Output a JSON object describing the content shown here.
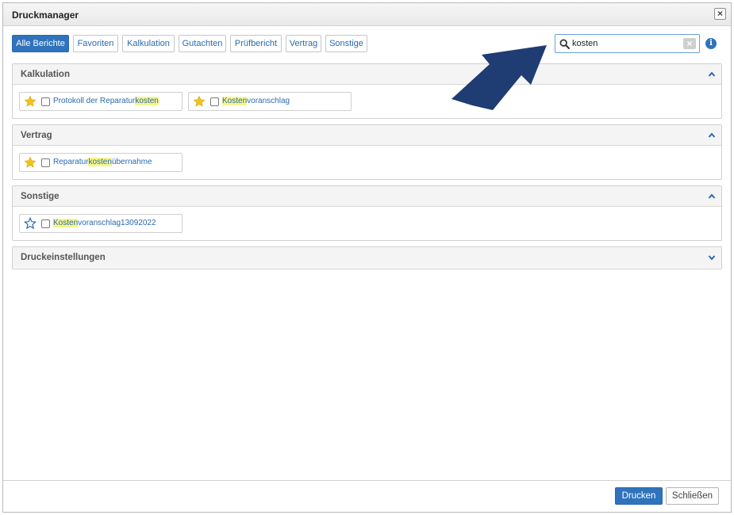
{
  "dialog": {
    "title": "Druckmanager",
    "close_symbol": "×"
  },
  "tabs": [
    {
      "label": "Alle Berichte",
      "active": true
    },
    {
      "label": "Favoriten",
      "active": false
    },
    {
      "label": "Kalkulation",
      "active": false
    },
    {
      "label": "Gutachten",
      "active": false
    },
    {
      "label": "Prüfbericht",
      "active": false
    },
    {
      "label": "Vertrag",
      "active": false
    },
    {
      "label": "Sonstige",
      "active": false
    }
  ],
  "search": {
    "value": "kosten",
    "icon": "search-icon",
    "clear_icon": "clear-icon"
  },
  "info": {
    "symbol": "i",
    "icon": "info-icon"
  },
  "sections": [
    {
      "title": "Kalkulation",
      "expanded": true,
      "reports": [
        {
          "prefix": "Protokoll der Reparatur",
          "match": "kosten",
          "suffix": "",
          "favorite": true,
          "checked": false
        },
        {
          "prefix": "",
          "match": "Kosten",
          "suffix": "voranschlag",
          "favorite": true,
          "checked": false
        }
      ]
    },
    {
      "title": "Vertrag",
      "expanded": true,
      "reports": [
        {
          "prefix": "Reparatur",
          "match": "kosten",
          "suffix": "übernahme",
          "favorite": true,
          "checked": false
        }
      ]
    },
    {
      "title": "Sonstige",
      "expanded": true,
      "reports": [
        {
          "prefix": "",
          "match": "Kosten",
          "suffix": "voranschlag13092022",
          "favorite": false,
          "checked": false
        }
      ]
    },
    {
      "title": "Druckeinstellungen",
      "expanded": false,
      "reports": []
    }
  ],
  "footer": {
    "print_label": "Drucken",
    "close_label": "Schließen"
  },
  "colors": {
    "accent": "#2f73bd",
    "link": "#2a6bb0",
    "star_filled": "#f2c21b",
    "star_outline": "#2a6bb0",
    "highlight": "#f7f58a",
    "annotation_arrow": "#1f3c73"
  }
}
